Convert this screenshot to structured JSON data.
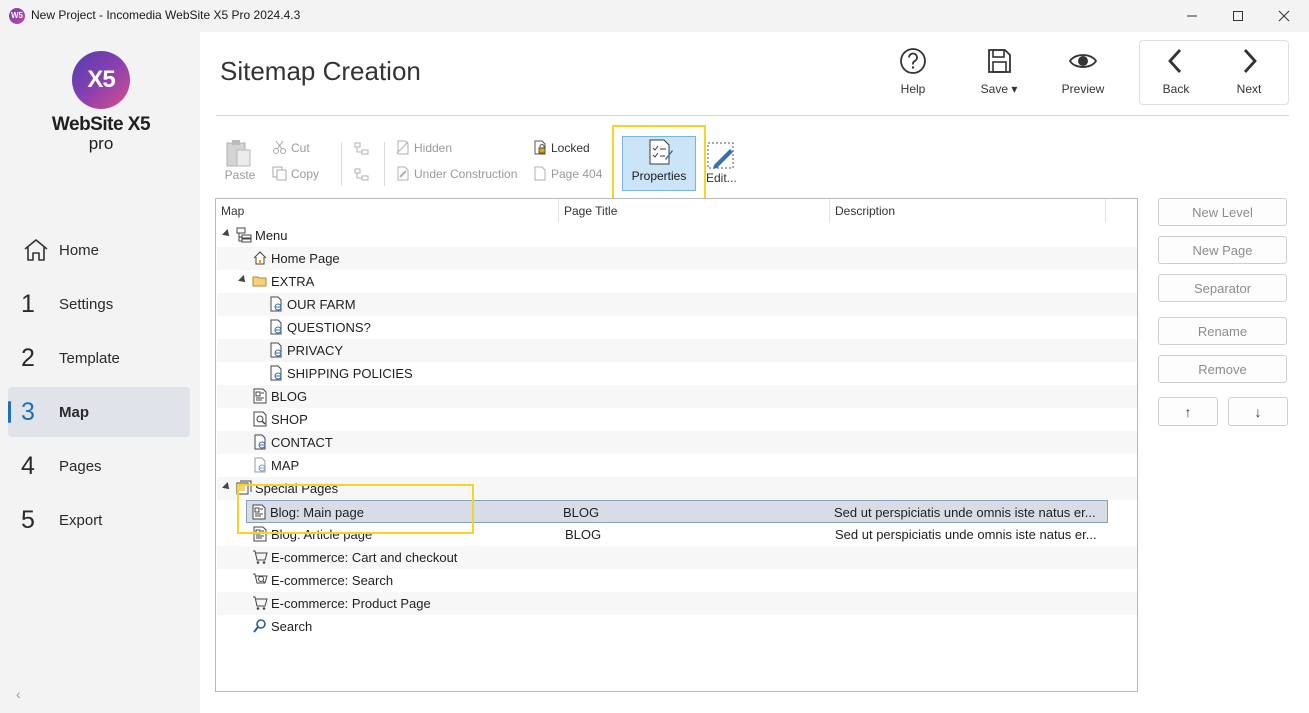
{
  "window": {
    "title": "New Project - Incomedia WebSite X5 Pro 2024.4.3",
    "app_icon": "W5"
  },
  "sidebar": {
    "logo_mark": "X5",
    "logo_text": "WebSite X5",
    "logo_sub": "pro",
    "items": [
      {
        "num": "",
        "label": "Home",
        "icon": "home-icon"
      },
      {
        "num": "1",
        "label": "Settings"
      },
      {
        "num": "2",
        "label": "Template"
      },
      {
        "num": "3",
        "label": "Map",
        "active": true
      },
      {
        "num": "4",
        "label": "Pages"
      },
      {
        "num": "5",
        "label": "Export"
      }
    ],
    "collapse": "‹"
  },
  "header": {
    "title": "Sitemap Creation",
    "help": "Help",
    "save": "Save ▾",
    "preview": "Preview",
    "back": "Back",
    "next": "Next"
  },
  "ribbon": {
    "paste": "Paste",
    "cut": "Cut",
    "copy": "Copy",
    "hidden": "Hidden",
    "under_construction": "Under Construction",
    "locked": "Locked",
    "page404": "Page 404",
    "properties": "Properties",
    "edit": "Edit..."
  },
  "tree": {
    "columns": [
      "Map",
      "Page Title",
      "Description"
    ],
    "rows": [
      {
        "label": "Menu",
        "title": "",
        "desc": ""
      },
      {
        "label": "Home Page",
        "title": "",
        "desc": ""
      },
      {
        "label": "EXTRA",
        "title": "",
        "desc": ""
      },
      {
        "label": "OUR FARM",
        "title": "",
        "desc": ""
      },
      {
        "label": "QUESTIONS?",
        "title": "",
        "desc": ""
      },
      {
        "label": "PRIVACY",
        "title": "",
        "desc": ""
      },
      {
        "label": "SHIPPING POLICIES",
        "title": "",
        "desc": ""
      },
      {
        "label": "BLOG",
        "title": "",
        "desc": ""
      },
      {
        "label": "SHOP",
        "title": "",
        "desc": ""
      },
      {
        "label": "CONTACT",
        "title": "",
        "desc": ""
      },
      {
        "label": "MAP",
        "title": "",
        "desc": ""
      },
      {
        "label": "Special Pages",
        "title": "",
        "desc": ""
      },
      {
        "label": "Blog: Main page",
        "title": "BLOG",
        "desc": "Sed ut perspiciatis unde omnis iste natus er..."
      },
      {
        "label": "Blog: Article page",
        "title": "BLOG",
        "desc": "Sed ut perspiciatis unde omnis iste natus er..."
      },
      {
        "label": "E-commerce: Cart and checkout",
        "title": "",
        "desc": ""
      },
      {
        "label": "E-commerce: Search",
        "title": "",
        "desc": ""
      },
      {
        "label": "E-commerce: Product Page",
        "title": "",
        "desc": ""
      },
      {
        "label": "Search",
        "title": "",
        "desc": ""
      }
    ]
  },
  "side_buttons": {
    "new_level": "New Level",
    "new_page": "New Page",
    "separator": "Separator",
    "rename": "Rename",
    "remove": "Remove",
    "up": "↑",
    "down": "↓"
  },
  "colors": {
    "accent": "#1f6fb5",
    "highlight": "#f5d327",
    "selected_row": "#d7dde6",
    "properties_bg": "#cce4f7"
  }
}
